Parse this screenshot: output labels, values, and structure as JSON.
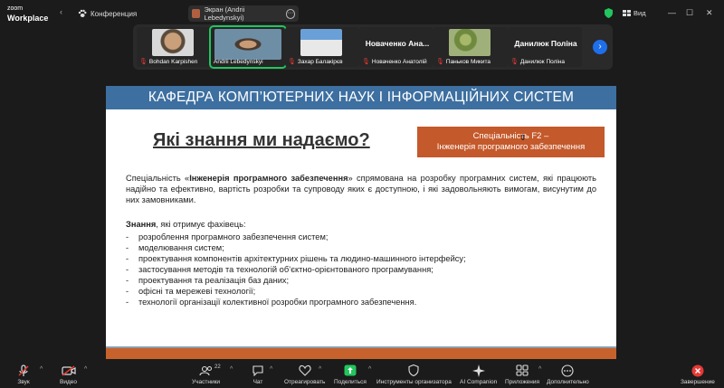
{
  "app": {
    "logo_line1": "zoom",
    "logo_line2": "Workplace",
    "conference_label": "Конференция",
    "screen_share_label": "Экран (Andrii Lebedynskyi)",
    "view_label": "Вид",
    "colors": {
      "accent_green": "#22c55e",
      "end_red": "#e53935",
      "blue": "#1f6feb"
    }
  },
  "participants": [
    {
      "name": "Bohdan Karpishen",
      "type": "video",
      "muted": true
    },
    {
      "name": "Andrii Lebedynskyi",
      "type": "video",
      "muted": false,
      "active": true
    },
    {
      "name": "Захар Балакірєв",
      "type": "video",
      "muted": true
    },
    {
      "name": "Новаченко Анатолій",
      "display_name": "Новаченко Ана...",
      "type": "name",
      "muted": true
    },
    {
      "name": "Паньков Микита",
      "type": "video",
      "muted": true
    },
    {
      "name": "Данилюк Поліна",
      "display_name": "Данилюк Поліна",
      "type": "name",
      "muted": true
    }
  ],
  "slide": {
    "header": "КАФЕДРА КОМП’ЮТЕРНИХ НАУК І ІНФОРМАЦІЙНИХ СИСТЕМ",
    "heading": "Які знання ми надаємо?",
    "spec_line1": "Спеціальність F2 –",
    "spec_line2": "Інженерія програмного забезпечення",
    "para_pre": "Спеціальність «",
    "para_bold": "Інженерія програмного забезпечення",
    "para_post": "» спрямована на розробку програмних систем, які працюють надійно та ефективно, вартість розробки та супроводу яких є доступною, і які задовольняють вимогам, висунутим до них замовниками.",
    "knowledge_bold": "Знання",
    "knowledge_rest": ", які отримує фахівець:",
    "items": [
      "розроблення програмного забезпечення систем;",
      "моделювання систем;",
      "проектування компонентів архітектурних рішень та людино-машинного інтерфейсу;",
      "застосування методів та технологій об’єктно-орієнтованого програмування;",
      "проектування та реалізація баз даних;",
      "офісні та мережеві технології;",
      "технології організації колективної розробки програмного забезпечення."
    ]
  },
  "toolbar": {
    "audio": "Звук",
    "video": "Видео",
    "participants": "Участники",
    "participants_count": "22",
    "chat": "Чат",
    "react": "Отреагировать",
    "share": "Поделиться",
    "host_tools": "Инструменты организатора",
    "ai": "AI Companion",
    "apps": "Приложения",
    "more": "Дополнительно",
    "end": "Завершение"
  }
}
